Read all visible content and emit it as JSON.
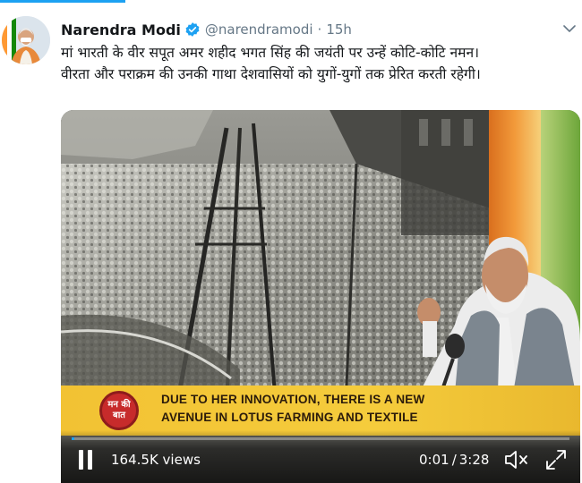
{
  "tweet": {
    "author_name": "Narendra Modi",
    "handle": "@narendramodi",
    "separator": "·",
    "time_ago": "15h",
    "text_line1": "मां भारती के वीर सपूत अमर शहीद भगत सिंह की जयंती पर उन्हें कोटि-कोटि नमन।",
    "text_line2": "वीरता और पराक्रम की उनकी गाथा देशवासियों को युगों-युगों तक प्रेरित करती रहेगी।"
  },
  "video": {
    "caption_line1": "DUE TO HER INNOVATION, THERE IS A NEW",
    "caption_line2": "AVENUE  IN LOTUS FARMING AND TEXTILE",
    "channel_logo_text": "मन की बात",
    "views": "164.5K views",
    "current_time": "0:01",
    "time_separator": "/",
    "duration": "3:28",
    "progress_fraction": 0.005
  },
  "colors": {
    "accent": "#1da1f2",
    "verified": "#1da1f2",
    "caption_band": "#f2c233",
    "logo_red": "#c72b2b"
  },
  "icons": {
    "verified": "verified-badge-icon",
    "menu": "chevron-down-icon",
    "pause": "pause-icon",
    "mute": "mute-icon",
    "fullscreen": "fullscreen-icon"
  }
}
